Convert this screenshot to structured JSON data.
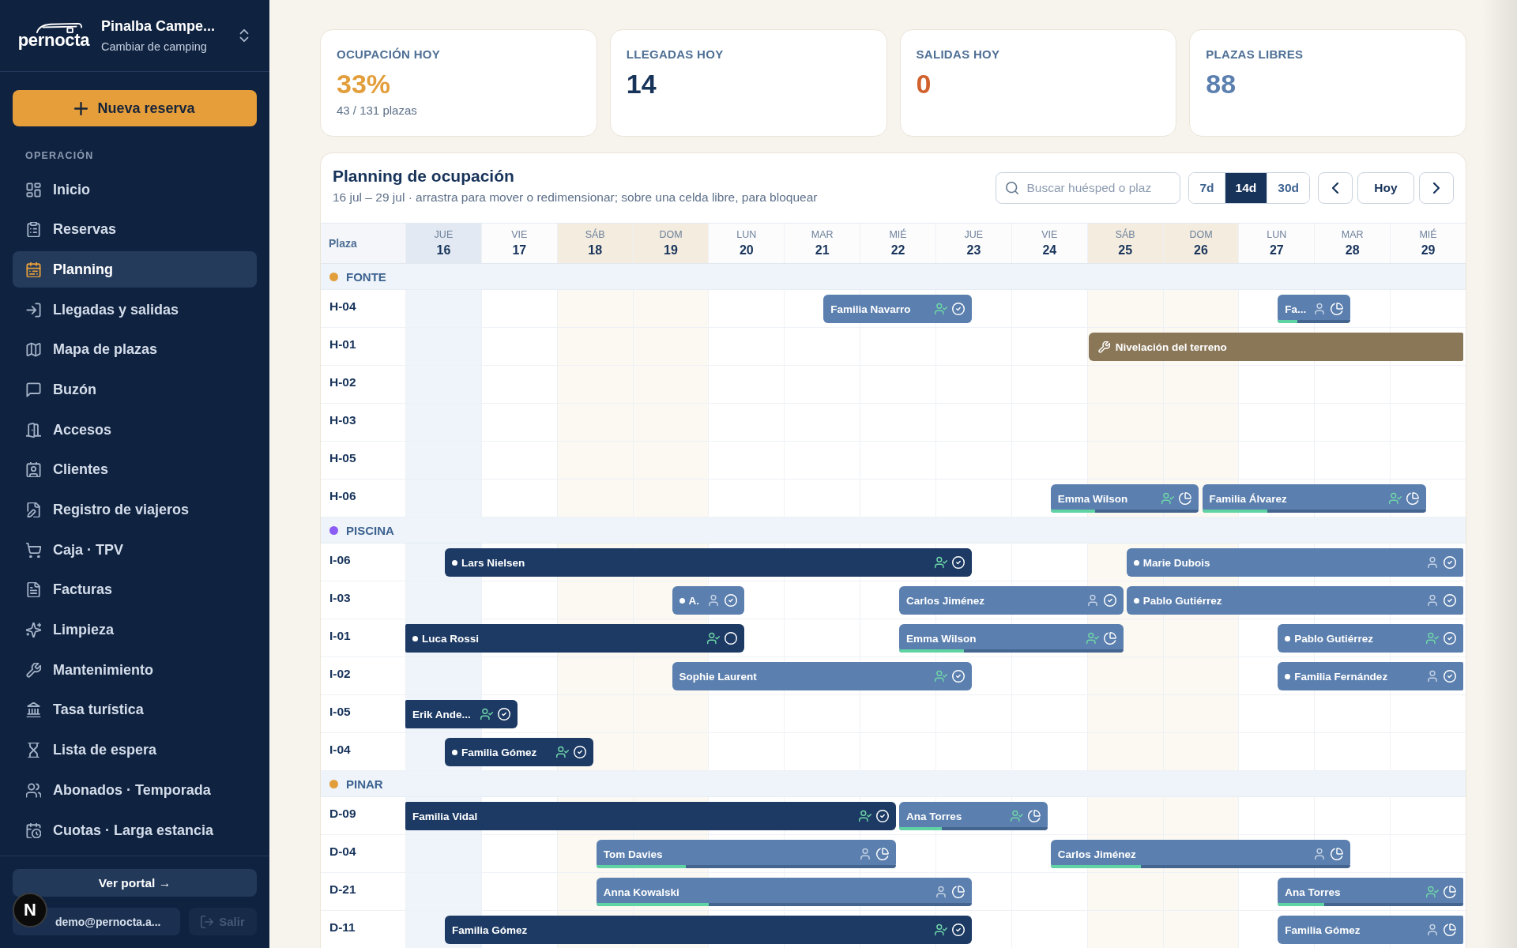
{
  "sidebar": {
    "logo": "pernocta",
    "campsite": {
      "name": "Pinalba Campe...",
      "action": "Cambiar de camping"
    },
    "new_button": "Nueva reserva",
    "section_label": "OPERACIÓN",
    "items": [
      {
        "label": "Inicio",
        "selected": false
      },
      {
        "label": "Reservas",
        "selected": false
      },
      {
        "label": "Planning",
        "selected": true
      },
      {
        "label": "Llegadas y salidas",
        "selected": false
      },
      {
        "label": "Mapa de plazas",
        "selected": false
      },
      {
        "label": "Buzón",
        "selected": false
      },
      {
        "label": "Accesos",
        "selected": false
      },
      {
        "label": "Clientes",
        "selected": false
      },
      {
        "label": "Registro de viajeros",
        "selected": false
      },
      {
        "label": "Caja · TPV",
        "selected": false
      },
      {
        "label": "Facturas",
        "selected": false
      },
      {
        "label": "Limpieza",
        "selected": false
      },
      {
        "label": "Mantenimiento",
        "selected": false
      },
      {
        "label": "Tasa turística",
        "selected": false
      },
      {
        "label": "Lista de espera",
        "selected": false
      },
      {
        "label": "Abonados · Temporada",
        "selected": false
      },
      {
        "label": "Cuotas · Larga estancia",
        "selected": false
      }
    ],
    "portal_button": "Ver portal →",
    "user": "demo@pernocta.a...",
    "logout": {
      "label": "Salir",
      "disabled": true
    }
  },
  "dev_badge": {
    "label": "N"
  },
  "stats": [
    {
      "label": "OCUPACIÓN HOY",
      "value": "33%",
      "color": "#e39e3c",
      "note": "43 / 131 plazas"
    },
    {
      "label": "LLEGADAS HOY",
      "value": "14",
      "color": "#17335a"
    },
    {
      "label": "SALIDAS HOY",
      "value": "0",
      "color": "#d2622d"
    },
    {
      "label": "PLAZAS LIBRES",
      "value": "88",
      "color": "#5b7fae"
    }
  ],
  "planning": {
    "title": "Planning de ocupación",
    "subtitle": "16 jul – 29 jul · arrastra para mover o redimensionar; sobre una celda libre, para bloquear",
    "search": {
      "placeholder": "Buscar huésped o plaz"
    },
    "ranges": [
      {
        "label": "7d",
        "selected": false
      },
      {
        "label": "14d",
        "selected": true
      },
      {
        "label": "30d",
        "selected": false
      }
    ],
    "today_button": "Hoy",
    "resource_heading": "Plaza",
    "days": [
      {
        "weekday": "JUE",
        "date": "16",
        "today": true,
        "weekend": false
      },
      {
        "weekday": "VIE",
        "date": "17",
        "today": false,
        "weekend": false
      },
      {
        "weekday": "SÁB",
        "date": "18",
        "today": false,
        "weekend": true
      },
      {
        "weekday": "DOM",
        "date": "19",
        "today": false,
        "weekend": true
      },
      {
        "weekday": "LUN",
        "date": "20",
        "today": false,
        "weekend": false
      },
      {
        "weekday": "MAR",
        "date": "21",
        "today": false,
        "weekend": false
      },
      {
        "weekday": "MIÉ",
        "date": "22",
        "today": false,
        "weekend": false
      },
      {
        "weekday": "JUE",
        "date": "23",
        "today": false,
        "weekend": false
      },
      {
        "weekday": "VIE",
        "date": "24",
        "today": false,
        "weekend": false
      },
      {
        "weekday": "SÁB",
        "date": "25",
        "today": false,
        "weekend": true
      },
      {
        "weekday": "DOM",
        "date": "26",
        "today": false,
        "weekend": true
      },
      {
        "weekday": "LUN",
        "date": "27",
        "today": false,
        "weekend": false
      },
      {
        "weekday": "MAR",
        "date": "28",
        "today": false,
        "weekend": false
      },
      {
        "weekday": "MIÉ",
        "date": "29",
        "today": false,
        "weekend": false
      }
    ],
    "sections": [
      {
        "name": "FONTE",
        "color": "#e39e3c",
        "rows": [
          {
            "plaza": "H-04",
            "half_days": [
              {
                "kind": "free"
              },
              {
                "kind": "free"
              },
              {
                "kind": "free"
              },
              {
                "kind": "free"
              },
              {
                "kind": "free"
              },
              {
                "kind": "free"
              },
              {
                "kind": "free"
              },
              {
                "kind": "free"
              },
              {
                "kind": "free"
              },
              {
                "kind": "free"
              },
              {
                "kind": "free"
              },
              {
                "kind": "arrival",
                "booking": {
                  "guest": "Familia Navarro",
                  "in_house": false,
                  "dot": false,
                  "checked_in": true,
                  "paid": true
                }
              },
              {
                "kind": "free"
              },
              {
                "kind": "free"
              },
              {
                "kind": "departure"
              },
              {
                "kind": "free"
              },
              {
                "kind": "free"
              },
              {
                "kind": "free"
              },
              {
                "kind": "free"
              },
              {
                "kind": "free"
              },
              {
                "kind": "free"
              },
              {
                "kind": "free"
              },
              {
                "kind": "free"
              },
              {
                "kind": "arrival",
                "booking": {
                  "guest": "Fa...",
                  "in_house": false,
                  "dot": false,
                  "checked_in": false,
                  "paid": false,
                  "partially_paid": true,
                  "level": 0.27
                }
              },
              {
                "kind": "departure"
              }
            ]
          },
          {
            "plaza": "H-01",
            "half_days": [
              {
                "kind": "free"
              },
              {
                "kind": "free"
              },
              {
                "kind": "free"
              },
              {
                "kind": "free"
              },
              {
                "kind": "free"
              },
              {
                "kind": "free"
              },
              {
                "kind": "free"
              },
              {
                "kind": "free"
              },
              {
                "kind": "free"
              },
              {
                "kind": "free"
              },
              {
                "kind": "free"
              },
              {
                "kind": "free"
              },
              {
                "kind": "free"
              },
              {
                "kind": "free"
              },
              {
                "kind": "free"
              },
              {
                "kind": "free"
              },
              {
                "kind": "free"
              },
              {
                "kind": "free"
              },
              {
                "kind": "block",
                "label": "Nivelación del terreno"
              }
            ]
          },
          {
            "plaza": "H-02"
          },
          {
            "plaza": "H-03"
          },
          {
            "plaza": "H-05"
          },
          {
            "plaza": "H-06",
            "half_days": [
              {
                "kind": "free"
              },
              {
                "kind": "free"
              },
              {
                "kind": "free"
              },
              {
                "kind": "free"
              },
              {
                "kind": "free"
              },
              {
                "kind": "free"
              },
              {
                "kind": "free"
              },
              {
                "kind": "free"
              },
              {
                "kind": "free"
              },
              {
                "kind": "free"
              },
              {
                "kind": "free"
              },
              {
                "kind": "free"
              },
              {
                "kind": "free"
              },
              {
                "kind": "free"
              },
              {
                "kind": "free"
              },
              {
                "kind": "free"
              },
              {
                "kind": "free"
              },
              {
                "kind": "arrival",
                "booking": {
                  "guest": "Emma Wilson",
                  "in_house": false,
                  "dot": false,
                  "checked_in": true,
                  "paid": false,
                  "partially_paid": true,
                  "level": 0.3
                }
              },
              {
                "kind": "free"
              },
              {
                "kind": "free"
              },
              {
                "kind": "departure"
              },
              {
                "kind": "arrival",
                "booking": {
                  "guest": "Familia Álvarez",
                  "in_house": false,
                  "dot": false,
                  "checked_in": true,
                  "paid": false,
                  "partially_paid": true,
                  "level": 0.29
                }
              },
              {
                "kind": "free"
              },
              {
                "kind": "free"
              },
              {
                "kind": "free"
              },
              {
                "kind": "free"
              },
              {
                "kind": "departure"
              }
            ]
          }
        ]
      },
      {
        "name": "PISCINA",
        "color": "#8b5cf6",
        "rows": [
          {
            "plaza": "I-06",
            "half_days": [
              {
                "kind": "free"
              },
              {
                "kind": "arrival",
                "booking": {
                  "guest": "Lars Nielsen",
                  "in_house": true,
                  "dot": true,
                  "checked_in": true,
                  "paid": true
                }
              },
              {
                "kind": "free"
              },
              {
                "kind": "free"
              },
              {
                "kind": "free"
              },
              {
                "kind": "free"
              },
              {
                "kind": "free"
              },
              {
                "kind": "free"
              },
              {
                "kind": "free"
              },
              {
                "kind": "free"
              },
              {
                "kind": "free"
              },
              {
                "kind": "free"
              },
              {
                "kind": "free"
              },
              {
                "kind": "free"
              },
              {
                "kind": "departure"
              },
              {
                "kind": "free"
              },
              {
                "kind": "free"
              },
              {
                "kind": "free"
              },
              {
                "kind": "free"
              },
              {
                "kind": "arrival",
                "booking": {
                  "guest": "Marie Dubois",
                  "in_house": false,
                  "dot": true,
                  "checked_in": false,
                  "paid": true
                }
              }
            ]
          },
          {
            "plaza": "I-03",
            "half_days": [
              {
                "kind": "free"
              },
              {
                "kind": "free"
              },
              {
                "kind": "free"
              },
              {
                "kind": "free"
              },
              {
                "kind": "free"
              },
              {
                "kind": "free"
              },
              {
                "kind": "free"
              },
              {
                "kind": "arrival",
                "booking": {
                  "guest": "A.",
                  "in_house": false,
                  "dot": true,
                  "checked_in": false,
                  "paid": true
                }
              },
              {
                "kind": "departure"
              },
              {
                "kind": "free"
              },
              {
                "kind": "free"
              },
              {
                "kind": "free"
              },
              {
                "kind": "free"
              },
              {
                "kind": "arrival",
                "booking": {
                  "guest": "Carlos Jiménez",
                  "in_house": false,
                  "dot": false,
                  "checked_in": false,
                  "paid": true
                }
              },
              {
                "kind": "free"
              },
              {
                "kind": "free"
              },
              {
                "kind": "free"
              },
              {
                "kind": "free"
              },
              {
                "kind": "departure"
              },
              {
                "kind": "arrival",
                "booking": {
                  "guest": "Pablo Gutiérrez",
                  "in_house": false,
                  "dot": true,
                  "checked_in": false,
                  "paid": true
                }
              }
            ]
          },
          {
            "plaza": "I-01",
            "half_days": [
              {
                "kind": "continuing",
                "booking": {
                  "guest": "Luca Rossi",
                  "in_house": true,
                  "dot": true,
                  "checked_in": true,
                  "paid": false,
                  "partially_paid": false
                }
              },
              {
                "kind": "free"
              },
              {
                "kind": "free"
              },
              {
                "kind": "free"
              },
              {
                "kind": "free"
              },
              {
                "kind": "free"
              },
              {
                "kind": "free"
              },
              {
                "kind": "free"
              },
              {
                "kind": "departure"
              },
              {
                "kind": "free"
              },
              {
                "kind": "free"
              },
              {
                "kind": "free"
              },
              {
                "kind": "free"
              },
              {
                "kind": "arrival",
                "booking": {
                  "guest": "Emma Wilson",
                  "in_house": false,
                  "dot": false,
                  "checked_in": true,
                  "paid": false,
                  "partially_paid": true,
                  "level": 0.29
                }
              },
              {
                "kind": "free"
              },
              {
                "kind": "free"
              },
              {
                "kind": "free"
              },
              {
                "kind": "free"
              },
              {
                "kind": "departure"
              },
              {
                "kind": "free"
              },
              {
                "kind": "free"
              },
              {
                "kind": "free"
              },
              {
                "kind": "free"
              },
              {
                "kind": "arrival",
                "booking": {
                  "guest": "Pablo Gutiérrez",
                  "in_house": false,
                  "dot": true,
                  "checked_in": true,
                  "paid": true
                }
              }
            ]
          },
          {
            "plaza": "I-02",
            "half_days": [
              {
                "kind": "free"
              },
              {
                "kind": "free"
              },
              {
                "kind": "free"
              },
              {
                "kind": "free"
              },
              {
                "kind": "free"
              },
              {
                "kind": "free"
              },
              {
                "kind": "free"
              },
              {
                "kind": "arrival",
                "booking": {
                  "guest": "Sophie Laurent",
                  "in_house": false,
                  "dot": false,
                  "checked_in": true,
                  "paid": true
                }
              },
              {
                "kind": "free"
              },
              {
                "kind": "free"
              },
              {
                "kind": "free"
              },
              {
                "kind": "free"
              },
              {
                "kind": "free"
              },
              {
                "kind": "free"
              },
              {
                "kind": "departure"
              },
              {
                "kind": "free"
              },
              {
                "kind": "free"
              },
              {
                "kind": "free"
              },
              {
                "kind": "free"
              },
              {
                "kind": "free"
              },
              {
                "kind": "free"
              },
              {
                "kind": "free"
              },
              {
                "kind": "free"
              },
              {
                "kind": "arrival",
                "booking": {
                  "guest": "Familia Fernández",
                  "in_house": false,
                  "dot": true,
                  "checked_in": false,
                  "paid": true
                }
              }
            ]
          },
          {
            "plaza": "I-05",
            "half_days": [
              {
                "kind": "continuing",
                "booking": {
                  "guest": "Erik Ande...",
                  "in_house": true,
                  "dot": false,
                  "checked_in": true,
                  "paid": true
                }
              },
              {
                "kind": "free"
              },
              {
                "kind": "departure"
              }
            ]
          },
          {
            "plaza": "I-04",
            "half_days": [
              {
                "kind": "free"
              },
              {
                "kind": "arrival",
                "booking": {
                  "guest": "Familia Gómez",
                  "in_house": true,
                  "dot": true,
                  "checked_in": true,
                  "paid": true
                }
              },
              {
                "kind": "free"
              },
              {
                "kind": "free"
              },
              {
                "kind": "departure"
              }
            ]
          }
        ]
      },
      {
        "name": "PINAR",
        "color": "#e39e3c",
        "rows": [
          {
            "plaza": "D-09",
            "half_days": [
              {
                "kind": "continuing",
                "booking": {
                  "guest": "Familia Vidal",
                  "in_house": true,
                  "dot": false,
                  "checked_in": true,
                  "paid": true
                }
              },
              {
                "kind": "free"
              },
              {
                "kind": "free"
              },
              {
                "kind": "free"
              },
              {
                "kind": "free"
              },
              {
                "kind": "free"
              },
              {
                "kind": "free"
              },
              {
                "kind": "free"
              },
              {
                "kind": "free"
              },
              {
                "kind": "free"
              },
              {
                "kind": "free"
              },
              {
                "kind": "free"
              },
              {
                "kind": "departure"
              },
              {
                "kind": "arrival",
                "booking": {
                  "guest": "Ana Torres",
                  "in_house": false,
                  "dot": false,
                  "checked_in": true,
                  "paid": false,
                  "partially_paid": true,
                  "level": 0.29
                }
              },
              {
                "kind": "free"
              },
              {
                "kind": "free"
              },
              {
                "kind": "departure"
              }
            ]
          },
          {
            "plaza": "D-04",
            "half_days": [
              {
                "kind": "free"
              },
              {
                "kind": "free"
              },
              {
                "kind": "free"
              },
              {
                "kind": "free"
              },
              {
                "kind": "free"
              },
              {
                "kind": "arrival",
                "booking": {
                  "guest": "Tom Davies",
                  "in_house": false,
                  "dot": false,
                  "checked_in": false,
                  "paid": false,
                  "partially_paid": true,
                  "level": 0.3
                }
              },
              {
                "kind": "free"
              },
              {
                "kind": "free"
              },
              {
                "kind": "free"
              },
              {
                "kind": "free"
              },
              {
                "kind": "free"
              },
              {
                "kind": "free"
              },
              {
                "kind": "departure"
              },
              {
                "kind": "free"
              },
              {
                "kind": "free"
              },
              {
                "kind": "free"
              },
              {
                "kind": "free"
              },
              {
                "kind": "arrival",
                "booking": {
                  "guest": "Carlos Jiménez",
                  "in_house": false,
                  "dot": false,
                  "checked_in": false,
                  "paid": false,
                  "partially_paid": true,
                  "level": 0.3
                }
              },
              {
                "kind": "free"
              },
              {
                "kind": "free"
              },
              {
                "kind": "free"
              },
              {
                "kind": "free"
              },
              {
                "kind": "free"
              },
              {
                "kind": "free"
              },
              {
                "kind": "departure"
              }
            ]
          },
          {
            "plaza": "D-21",
            "half_days": [
              {
                "kind": "free"
              },
              {
                "kind": "free"
              },
              {
                "kind": "free"
              },
              {
                "kind": "free"
              },
              {
                "kind": "free"
              },
              {
                "kind": "arrival",
                "booking": {
                  "guest": "Anna Kowalski",
                  "in_house": false,
                  "dot": false,
                  "checked_in": false,
                  "paid": false,
                  "partially_paid": true,
                  "level": 0.3
                }
              },
              {
                "kind": "free"
              },
              {
                "kind": "free"
              },
              {
                "kind": "free"
              },
              {
                "kind": "free"
              },
              {
                "kind": "free"
              },
              {
                "kind": "free"
              },
              {
                "kind": "free"
              },
              {
                "kind": "free"
              },
              {
                "kind": "departure"
              },
              {
                "kind": "free"
              },
              {
                "kind": "free"
              },
              {
                "kind": "free"
              },
              {
                "kind": "free"
              },
              {
                "kind": "free"
              },
              {
                "kind": "free"
              },
              {
                "kind": "free"
              },
              {
                "kind": "free"
              },
              {
                "kind": "arrival",
                "booking": {
                  "guest": "Ana Torres",
                  "in_house": false,
                  "dot": false,
                  "checked_in": true,
                  "paid": false,
                  "partially_paid": true,
                  "level": 0.25
                }
              }
            ]
          },
          {
            "plaza": "D-11",
            "half_days": [
              {
                "kind": "free"
              },
              {
                "kind": "arrival",
                "booking": {
                  "guest": "Familia Gómez",
                  "in_house": true,
                  "dot": false,
                  "checked_in": true,
                  "paid": true
                }
              },
              {
                "kind": "free"
              },
              {
                "kind": "free"
              },
              {
                "kind": "free"
              },
              {
                "kind": "free"
              },
              {
                "kind": "free"
              },
              {
                "kind": "free"
              },
              {
                "kind": "free"
              },
              {
                "kind": "free"
              },
              {
                "kind": "free"
              },
              {
                "kind": "free"
              },
              {
                "kind": "free"
              },
              {
                "kind": "free"
              },
              {
                "kind": "departure"
              },
              {
                "kind": "free"
              },
              {
                "kind": "free"
              },
              {
                "kind": "free"
              },
              {
                "kind": "free"
              },
              {
                "kind": "free"
              },
              {
                "kind": "free"
              },
              {
                "kind": "free"
              },
              {
                "kind": "free"
              },
              {
                "kind": "arrival",
                "booking": {
                  "guest": "Familia Gómez",
                  "in_house": false,
                  "dot": false,
                  "checked_in": false,
                  "paid": false,
                  "partially_paid": true
                }
              }
            ]
          }
        ]
      }
    ]
  }
}
